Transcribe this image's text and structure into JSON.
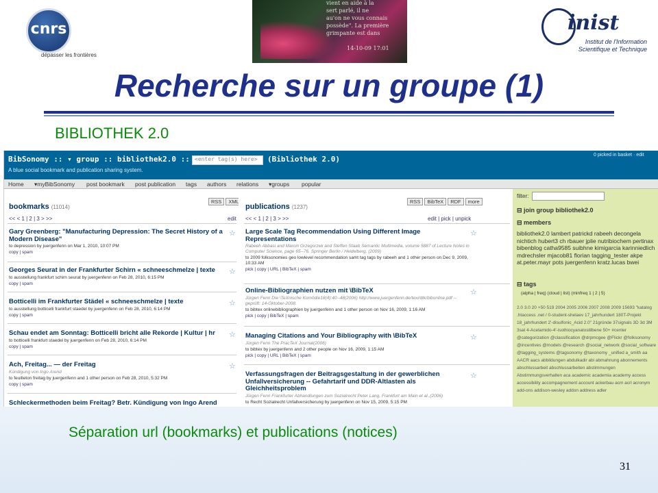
{
  "header": {
    "cnrs_logo_text": "cnrs",
    "cnrs_tagline": "dépasser les frontières",
    "banner_lines": [
      "vient en aide à la",
      "sert parlé, il ne",
      "au'on ne vous connais",
      "possède\". La première",
      "grimpante est dans",
      "14-10-09 17:01"
    ],
    "inist_logo_text": "inist",
    "inist_subtitle_1": "Institut de l'Information",
    "inist_subtitle_2": "Scientifique et Technique"
  },
  "slide": {
    "title": "Recherche sur un groupe (1)",
    "subtitle": "BIBLIOTHEK 2.0",
    "caption": "Séparation url (bookmarks) et publications (notices)",
    "page_number": "31"
  },
  "bibsonomy": {
    "title_prefix": "BibSonomy :: ▾ group :: bibliothek2.0 ::",
    "tag_placeholder": "<enter tag(s) here>",
    "title_suffix": "(Bibliothek 2.0)",
    "tagline": "A blue social bookmark and publication sharing system.",
    "top_right": "0  picked in  basket · edit",
    "nav": [
      "Home",
      "▾myBibSonomy",
      "post bookmark",
      "post publication",
      "tags",
      "authors",
      "relations",
      "▾groups",
      "popular"
    ],
    "bookmarks": {
      "heading": "bookmarks",
      "count": "(11014)",
      "buttons": [
        "RSS",
        "XML"
      ],
      "pager": "<< < 1 | 2 | 3 > >>",
      "edit": "edit",
      "entries": [
        {
          "title": "Gary Greenberg: \"Manufacturing Depression: The Secret History of a Modern Disease\"",
          "meta": "to depression by juergenfenn on Mar 1, 2010, 10:07 PM",
          "actions": "copy | spam"
        },
        {
          "title": "Georges Seurat in der Frankfurter Schirn « schneeschmelze | texte",
          "meta": "to ausstellung frankfurt schirn seurat by juergenfenn on Feb 28, 2010, 6:15 PM",
          "actions": "copy | spam"
        },
        {
          "title": "Botticelli im Frankfurter Städel « schneeschmelze | texte",
          "meta": "to ausstellung botticelli frankfurt staedel by juergenfenn on Feb 28, 2010, 6:14 PM",
          "actions": "copy | spam"
        },
        {
          "title": "Schau endet am Sonntag: Botticelli bricht alle Rekorde | Kultur | hr",
          "meta": "to botticelli frankfurt staedel by juergenfenn on Feb 28, 2010, 6:14 PM",
          "actions": "copy | spam"
        },
        {
          "title": "Ach, Freitag... — der Freitag",
          "sub": "Kündigung von Ingo Arend",
          "meta": "to feuilleton freitag by juergenfenn and 1 other person on Feb 28, 2010, 5:32 PM",
          "actions": "copy | spam"
        },
        {
          "title": "Schleckermethoden beim Freitag? Betr. Kündigung von Ingo Arend",
          "meta": "",
          "actions": ""
        }
      ]
    },
    "publications": {
      "heading": "publications",
      "count": "(1237)",
      "buttons": [
        "RSS",
        "BibTeX",
        "RDF",
        "more"
      ],
      "pager": "<< < 1 | 2 | 3 > >>",
      "actions_right": "edit | pick | unpick",
      "entries": [
        {
          "title": "Large Scale Tag Recommendation Using Different Image Representations",
          "sub": "Rabeeh Abbasi and Marcin Grzegorzek and Steffen Staab Semantic Multimedia, volume 5887 of Lecture Notes in Computer Science, page 65--76. Springer Berlin / Heidelberg, (2009)",
          "meta": "to 2009 folksonomies geo lowlevel recommendation samt tag tags by rabeeh and 1 other person on Dec 9, 2009, 10:33 AM",
          "actions": "pick | copy | URL | BibTeX | spam"
        },
        {
          "title": "Online-Bibliographien nutzen mit \\BibTeX",
          "sub": "Jürgen Fenn Die \\TeXnische Komödie18(4):40--48(2006) http://www.juergenfenn.de/texi/dtk/bibonline.pdf -- geprüft: 14-Oktober-2008.",
          "meta": "to bibtex onlinebibliographien by juergenfenn and 1 other person on Nov 16, 2009, 1:16 AM",
          "actions": "pick | copy | BibTeX | spam"
        },
        {
          "title": "Managing Citations and Your Bibliography with \\BibTeX",
          "sub": "Jürgen Fenn The PracTeX Journal(2006)",
          "meta": "to bibtex by juergenfenn and 2 other people on Nov 16, 2009, 1:15 AM",
          "actions": "pick | copy | URL | BibTeX | spam"
        },
        {
          "title": "Verfassungsfragen der Beitragsgestaltung in der gewerblichen Unfallversicherung -- Gefahrtarif und DDR-Altlasten als Gleichheitsproblem",
          "sub": "Jürgen Fenn Frankfurter Abhandlungen zum Sozialrecht Peter Lang, Frankfurt am Main et al.,(2006)",
          "meta": "to Recht Sozialrecht Unfallversicherung by juergenfenn on Nov 15, 2009, 5:15 PM",
          "actions": ""
        }
      ]
    },
    "sidebar": {
      "filter_label": "filter:",
      "join_group": "join group bibliothek2.0",
      "members_heading": "members",
      "members": "bibliothek2.0   lambert   patrickd   rabeeh   decongela   nichtich   hubert3   ch   rbauer   jplie   nutribiochem   pertinax   bibenblog   catha9585   suibhne   kimigarcia   karinniedlich   mdrechsler   mjacob81   florian   tagging_tester   akpe   at.peter.mayr   pots   juergenfenn   kratz.lucas   bwei",
      "tags_heading": "tags",
      "tag_modes": "(alpha | freq)   (cloud | list)   (minfreq 1 | 2 | 5)",
      "tags": "2.0  3.0  20  +50  519  2004  2005  2006  2007  2008  2009  15693  \"katalog  .htaccess  .net  /  0-student-shelaev  17_jahrhundert  180T-Projekt  18_jahrhundert  2'-disulfonic_Acid  2.0\"  21gründe  37signals  3D  3d  3M  3sat  4-Acetamido-4'-isothiocyanatostilbene  50+  #center  @categorization  @classification  @drpmcgee  @Flickr  @folksonomy  @incentives  @models  @research  @social_network  @social_software  @tagging_systems  @tagsonomy  @taxonomy  _unified  a_smith  aa  AACR  aacs  abbildungen  abdulkadir  abi  abmahnung  abonnements  abschlussarbeit  abschlussarbeiten  abstimmungen  Abstimmungsverhalten  aca  academic  academia  academy  access  accessibility  accompagnement  account  ackerbau  acm  acrl  acronym  add-ons  addison-wesley  addon  address  adler"
    }
  },
  "colors": {
    "title": "#1f2f8c",
    "green_text": "#0a8a0a",
    "bibsonomy_header": "#006699",
    "sidebar_bg": "#dfeab0"
  }
}
